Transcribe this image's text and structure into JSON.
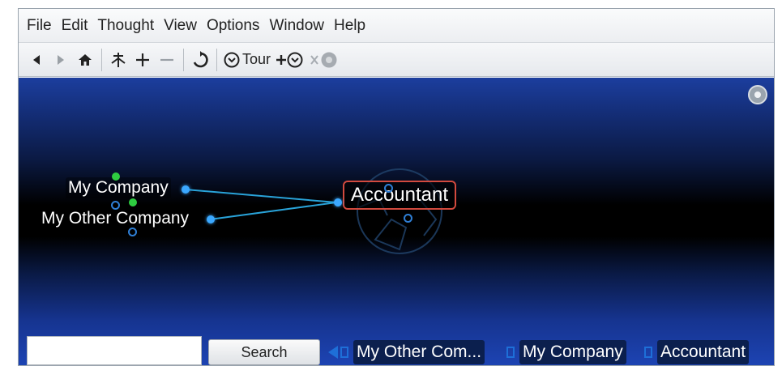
{
  "menubar": {
    "items": [
      "File",
      "Edit",
      "Thought",
      "View",
      "Options",
      "Window",
      "Help"
    ]
  },
  "toolbar": {
    "back_icon": "back-arrow",
    "forward_icon": "forward-arrow",
    "home_icon": "home",
    "link_icon": "link-thought",
    "add_icon": "plus",
    "remove_icon": "minus",
    "refresh_icon": "refresh",
    "tour_label": "Tour",
    "add_tour_icon": "add-tour",
    "remove_tour_icon": "remove-tour"
  },
  "plex": {
    "active_thought": "Accountant",
    "thoughts": [
      {
        "label": "My Company"
      },
      {
        "label": "My Other Company"
      }
    ],
    "colors": {
      "link": "#29a3d9",
      "active_border": "#d24a3e",
      "gate_blue": "#3ba8ff",
      "gate_green": "#2ecc40"
    }
  },
  "search": {
    "input_value": "",
    "button_label": "Search"
  },
  "history": {
    "items": [
      "My Other Com...",
      "My Company",
      "Accountant"
    ]
  }
}
